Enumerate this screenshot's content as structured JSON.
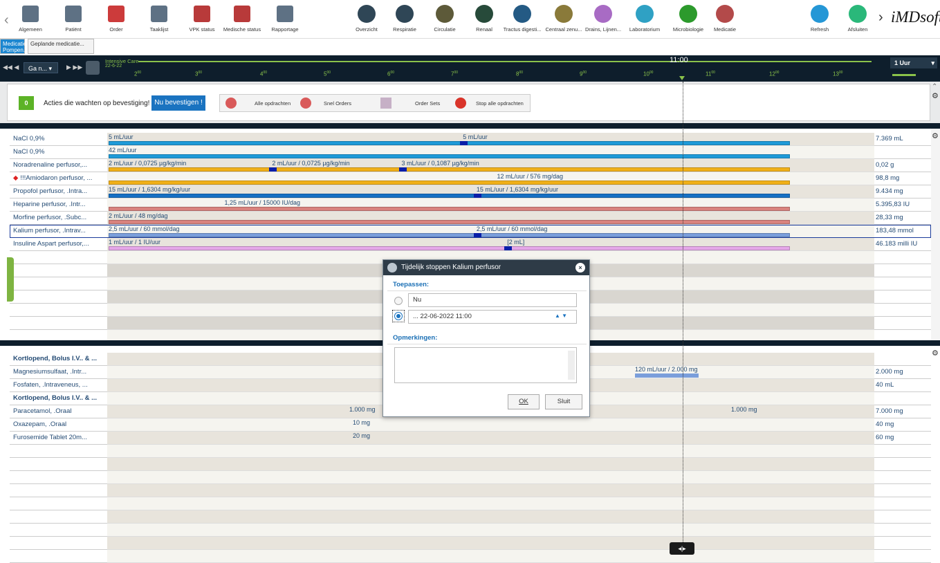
{
  "toolbar": {
    "left": [
      {
        "label": "Algemeen",
        "icon": "hospital-icon",
        "color": "#5e7184"
      },
      {
        "label": "Patiënt",
        "icon": "printer-icon",
        "color": "#5e7184"
      },
      {
        "label": "Order",
        "icon": "pill-icon",
        "color": "#cc3b3b"
      },
      {
        "label": "Taaklijst",
        "icon": "checklist-icon",
        "color": "#5e7184"
      },
      {
        "label": "VPK status",
        "icon": "monitor-icon",
        "color": "#b83a3a"
      },
      {
        "label": "Medische status",
        "icon": "medical-record-icon",
        "color": "#b83a3a"
      },
      {
        "label": "Rapportage",
        "icon": "clipboard-icon",
        "color": "#5e7184"
      }
    ],
    "middle": [
      {
        "label": "Overzicht",
        "icon": "home-icon",
        "color": "#2f4656"
      },
      {
        "label": "Respiratie",
        "icon": "lungs-icon",
        "color": "#2f4656"
      },
      {
        "label": "Circulatie",
        "icon": "heart-icon",
        "color": "#5d5a39"
      },
      {
        "label": "Renaal",
        "icon": "kidney-icon",
        "color": "#274a3a"
      },
      {
        "label": "Tractus digesti...",
        "icon": "stomach-icon",
        "color": "#245a84"
      },
      {
        "label": "Centraal zenu...",
        "icon": "brain-icon",
        "color": "#8a7a3a"
      },
      {
        "label": "Drains, Lijnen...",
        "icon": "share-icon",
        "color": "#a86bc4"
      },
      {
        "label": "Laboratorium",
        "icon": "flask-icon",
        "color": "#2fa1c4"
      },
      {
        "label": "Microbiologie",
        "icon": "virus-icon",
        "color": "#2c9a2c"
      },
      {
        "label": "Medicatie",
        "icon": "medication-icon",
        "color": "#b34a4a"
      }
    ],
    "right": [
      {
        "label": "Refresh",
        "icon": "refresh-icon",
        "color": "#2597d6"
      },
      {
        "label": "Afsluiten",
        "icon": "power-icon",
        "color": "#2ab87a"
      }
    ],
    "brand": "iMDsoft"
  },
  "subtabs": [
    {
      "label": "Medicatie Pompen..."
    },
    {
      "label": "Geplande medicatie..."
    }
  ],
  "timebar": {
    "goto": "Ga n...",
    "ward": "Intensive Care",
    "date": "22-6-22",
    "hours": [
      "2",
      "3",
      "4",
      "5",
      "6",
      "7",
      "8",
      "9",
      "10",
      "11",
      "12",
      "13"
    ],
    "cursor_time": "11:00",
    "scale": "1 Uur"
  },
  "actions": {
    "badge": "0",
    "text": "Acties die wachten op bevestiging!",
    "confirm": "Nu bevestigen !",
    "buttons": [
      "Alle opdrachten",
      "Snel Orders",
      "Order Sets",
      "Stop alle opdrachten"
    ]
  },
  "top_rows": [
    {
      "name": "NaCl 0,9%",
      "total": "7.369 mL",
      "labels": [
        {
          "t": "5 mL/uur",
          "x": 0
        },
        {
          "t": "5 mL/uur",
          "x": 0.52
        }
      ],
      "color": "#1e9ad8"
    },
    {
      "name": "NaCl 0,9%",
      "total": "",
      "labels": [
        {
          "t": "42 mL/uur",
          "x": 0
        }
      ],
      "color": "#1e9ad8"
    },
    {
      "name": "Noradrenaline perfusor,...",
      "total": "0,02 g",
      "labels": [
        {
          "t": "2 mL/uur / 0,0725 µg/kg/min",
          "x": 0
        },
        {
          "t": "2 mL/uur / 0,0725 µg/kg/min",
          "x": 0.24
        },
        {
          "t": "3 mL/uur / 0,1087 µg/kg/min",
          "x": 0.43
        }
      ],
      "color": "#f0b019"
    },
    {
      "name": "!!!Amiodaron perfusor, ...",
      "total": "98,8 mg",
      "alert": true,
      "labels": [
        {
          "t": "12 mL/uur / 576 mg/dag",
          "x": 0.57
        }
      ],
      "color": "#f0b019"
    },
    {
      "name": "Propofol perfusor, .Intra...",
      "total": "9.434 mg",
      "labels": [
        {
          "t": "15 mL/uur / 1,6304 mg/kg/uur",
          "x": 0
        },
        {
          "t": "15 mL/uur / 1,6304 mg/kg/uur",
          "x": 0.54
        }
      ],
      "color": "#1670c4"
    },
    {
      "name": "Heparine perfusor, .Intr...",
      "total": "5.395,83 IU",
      "labels": [
        {
          "t": "1,25 mL/uur / 15000 IU/dag",
          "x": 0.17
        }
      ],
      "color": "#d9837e"
    },
    {
      "name": "Morfine perfusor, .Subc...",
      "total": "28,33 mg",
      "labels": [
        {
          "t": "2 mL/uur / 48 mg/dag",
          "x": 0
        }
      ],
      "color": "#d9837e"
    },
    {
      "name": "Kalium perfusor, .Intrav...",
      "total": "183,48 mmol",
      "labels": [
        {
          "t": "2,5 mL/uur / 60 mmol/dag",
          "x": 0
        },
        {
          "t": "2,5 mL/uur / 60 mmol/dag",
          "x": 0.54
        }
      ],
      "color": "#7a9edb"
    },
    {
      "name": "Insuline Aspart perfusor,...",
      "total": "46.183 milli IU",
      "labels": [
        {
          "t": "1 mL/uur / 1 IU/uur",
          "x": 0
        },
        {
          "t": "[2 mL]",
          "x": 0.585
        }
      ],
      "color": "#e5a7e8"
    }
  ],
  "bottom_rows": [
    {
      "name": "Kortlopend, Bolus I.V.. & ...",
      "bold": true,
      "total": ""
    },
    {
      "name": "Magnesiumsulfaat, .Intr...",
      "total": "2.000 mg"
    },
    {
      "name": "Fosfaten, .Intraveneus, ...",
      "total": "40 mL"
    },
    {
      "name": "Kortlopend, Bolus I.V.. & ...",
      "bold": true,
      "total": ""
    },
    {
      "name": "Paracetamol, .Oraal",
      "total": "7.000 mg"
    },
    {
      "name": "Oxazepam, .Oraal",
      "total": "40 mg"
    },
    {
      "name": "Furosemide Tablet 20m...",
      "total": "60 mg"
    }
  ],
  "bottom_labels": {
    "magnesium": "120 mL/uur / 2.000 mg",
    "para1": "1.000 mg",
    "para2": "1.000 mg",
    "oxa": "10 mg",
    "furo": "20 mg"
  },
  "dialog": {
    "title": "Tijdelijk stoppen Kalium perfusor",
    "apply_label": "Toepassen:",
    "opt_now": "Nu",
    "opt_date": "... 22-06-2022 11:00",
    "remarks_label": "Opmerkingen:",
    "ok": "OK",
    "close": "Sluit"
  }
}
